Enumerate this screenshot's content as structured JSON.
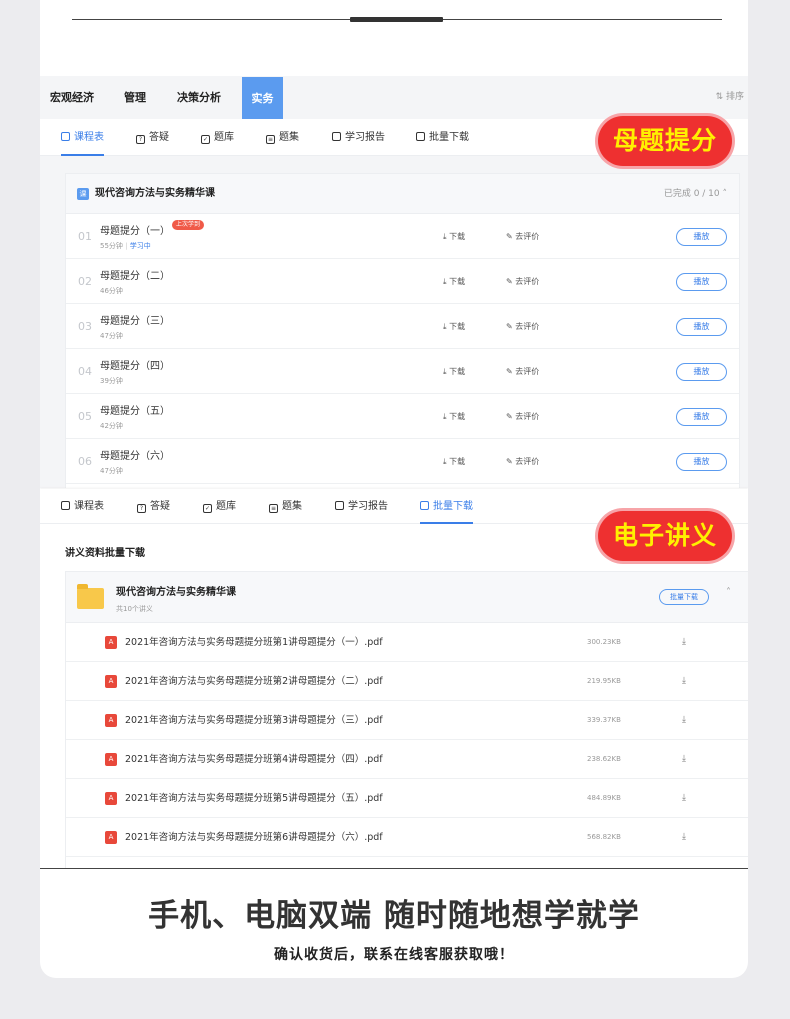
{
  "categories": [
    {
      "label": "宏观经济",
      "active": false
    },
    {
      "label": "管理",
      "active": false
    },
    {
      "label": "决策分析",
      "active": false
    },
    {
      "label": "实务",
      "active": true
    }
  ],
  "sort_label": "排序",
  "sub_tabs": [
    "课程表",
    "答疑",
    "题库",
    "题集",
    "学习报告",
    "批量下载"
  ],
  "course": {
    "title": "现代咨询方法与实务精华课",
    "badge": "课",
    "progress": "已完成 0 / 10",
    "download_label": "下载",
    "rate_label": "去评价",
    "play_label": "播放",
    "last_tag": "上次学到",
    "studying_label": "学习中",
    "lessons": [
      {
        "num": "01",
        "title": "母题提分（一）",
        "duration": "55分钟"
      },
      {
        "num": "02",
        "title": "母题提分（二）",
        "duration": "46分钟"
      },
      {
        "num": "03",
        "title": "母题提分（三）",
        "duration": "47分钟"
      },
      {
        "num": "04",
        "title": "母题提分（四）",
        "duration": "39分钟"
      },
      {
        "num": "05",
        "title": "母题提分（五）",
        "duration": "42分钟"
      },
      {
        "num": "06",
        "title": "母题提分（六）",
        "duration": "47分钟"
      }
    ]
  },
  "sticker1": "母题提分",
  "sticker2": "电子讲义",
  "batch": {
    "section_title": "讲义资料批量下载",
    "folder_title": "现代咨询方法与实务精华课",
    "folder_count": "共10个讲义",
    "batch_button": "批量下载",
    "files": [
      {
        "name": "2021年咨询方法与实务母题提分班第1讲母题提分（一）.pdf",
        "size": "300.23KB"
      },
      {
        "name": "2021年咨询方法与实务母题提分班第2讲母题提分（二）.pdf",
        "size": "219.95KB"
      },
      {
        "name": "2021年咨询方法与实务母题提分班第3讲母题提分（三）.pdf",
        "size": "339.37KB"
      },
      {
        "name": "2021年咨询方法与实务母题提分班第4讲母题提分（四）.pdf",
        "size": "238.62KB"
      },
      {
        "name": "2021年咨询方法与实务母题提分班第5讲母题提分（五）.pdf",
        "size": "484.89KB"
      },
      {
        "name": "2021年咨询方法与实务母题提分班第6讲母题提分（六）.pdf",
        "size": "568.82KB"
      }
    ]
  },
  "footer": {
    "slogan": "手机、电脑双端  随时随地想学就学",
    "contact": "确认收货后，联系在线客服获取哦！"
  },
  "colors": {
    "accent": "#3a7ee8",
    "tab_active_bg": "#5b9bef",
    "sticker_red": "#ee3030",
    "sticker_text": "#fff000"
  }
}
